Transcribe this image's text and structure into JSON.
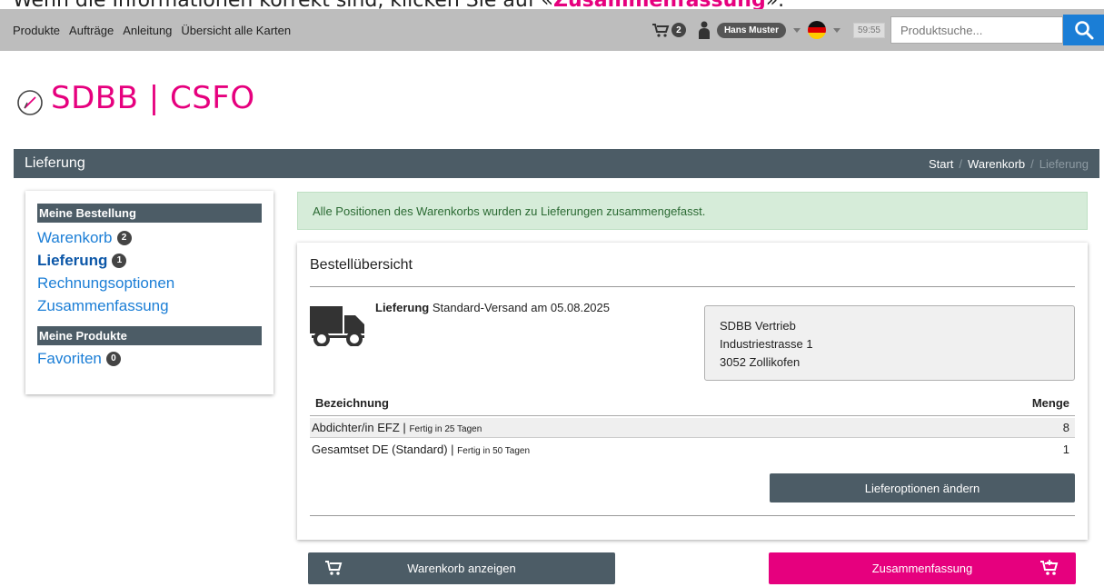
{
  "instruction": {
    "prefix": "Wenn die Informationen korrekt sind, klicken Sie auf «",
    "highlight": "Zusammenfassung",
    "suffix": "»."
  },
  "topbar": {
    "nav": [
      "Produkte",
      "Aufträge",
      "Anleitung",
      "Übersicht alle Karten"
    ],
    "cart_count": "2",
    "user_name": "Hans Muster",
    "timer": "59:55",
    "search_placeholder": "Produktsuche..."
  },
  "logo": {
    "text": "SDBB | CSFO"
  },
  "titlebar": {
    "title": "Lieferung",
    "breadcrumb": {
      "start": "Start",
      "cart": "Warenkorb",
      "current": "Lieferung",
      "sep": "/"
    }
  },
  "sidebar": {
    "order_heading": "Meine Bestellung",
    "cart_label": "Warenkorb",
    "cart_count": "2",
    "delivery_label": "Lieferung",
    "delivery_count": "1",
    "billing_label": "Rechnungsoptionen",
    "summary_label": "Zusammenfassung",
    "products_heading": "Meine Produkte",
    "favorites_label": "Favoriten",
    "favorites_count": "0"
  },
  "alert": {
    "text": "Alle Positionen des Warenkorbs wurden zu Lieferungen zusammengefasst."
  },
  "overview": {
    "title": "Bestellübersicht",
    "delivery_label": "Lieferung",
    "delivery_text": "Standard-Versand am 05.08.2025",
    "address": [
      "SDBB Vertrieb",
      "Industriestrasse 1",
      "3052 Zollikofen"
    ],
    "col_name": "Bezeichnung",
    "col_qty": "Menge",
    "rows": [
      {
        "name": "Abdichter/in EFZ |",
        "note": "Fertig in 25 Tagen",
        "qty": "8"
      },
      {
        "name": "Gesamtset DE (Standard) |",
        "note": "Fertig in 50 Tagen",
        "qty": "1"
      }
    ],
    "change_button": "Lieferoptionen ändern"
  },
  "footer": {
    "cart_button": "Warenkorb anzeigen",
    "summary_button": "Zusammenfassung"
  },
  "colors": {
    "brand_pink": "#e6007e",
    "bar": "#4c5c66",
    "link": "#1b7ed6"
  }
}
